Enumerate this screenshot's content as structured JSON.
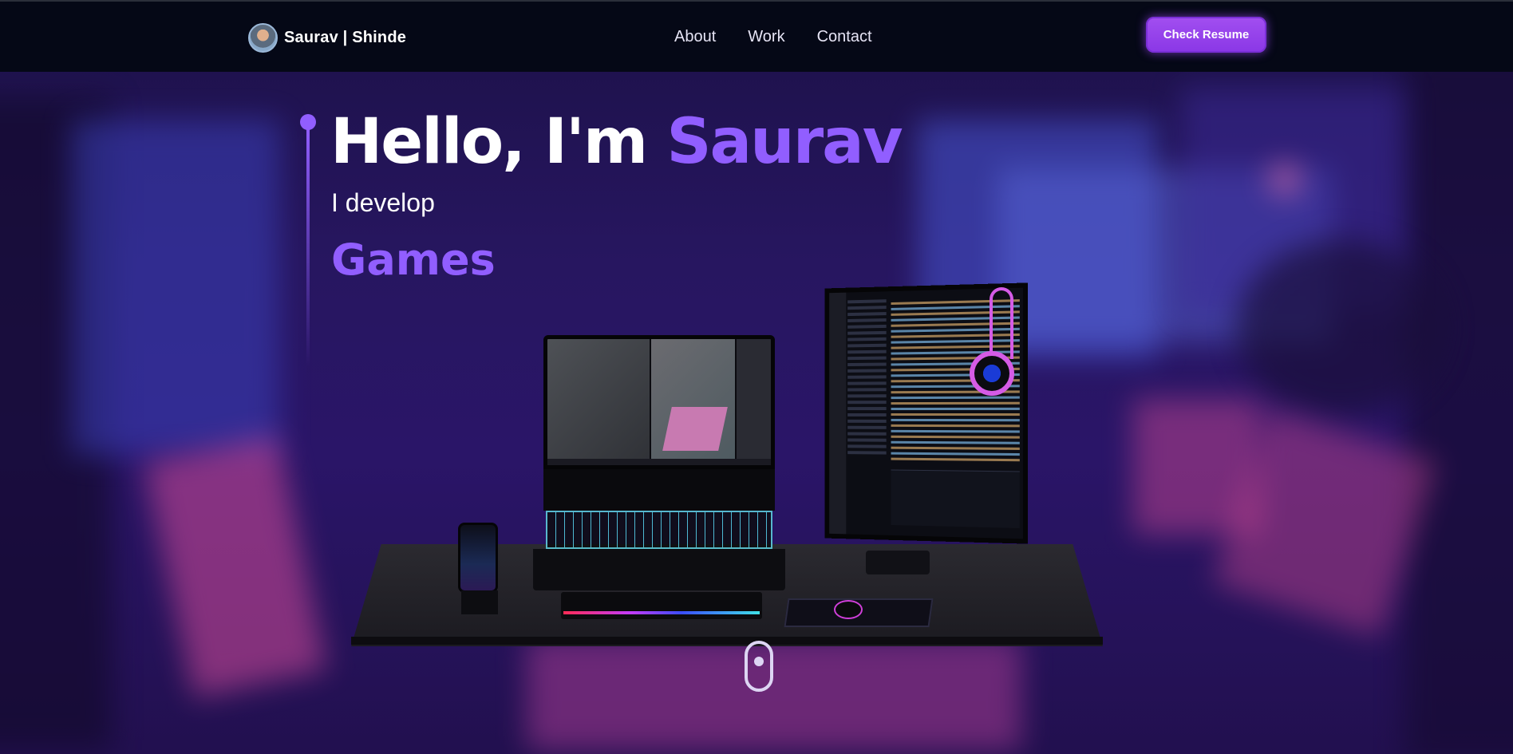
{
  "header": {
    "brand_name": "Saurav | Shinde",
    "nav": [
      {
        "label": "About"
      },
      {
        "label": "Work"
      },
      {
        "label": "Contact"
      }
    ],
    "resume_button": "Check Resume"
  },
  "hero": {
    "greeting": "Hello, I'm ",
    "name": "Saurav",
    "subtitle": "I develop",
    "role": "Games"
  },
  "colors": {
    "accent": "#915eff",
    "header_bg": "#050816",
    "button": "#9a46ee"
  },
  "icons": {
    "avatar": "user-avatar-icon",
    "scroll": "scroll-mouse-icon"
  }
}
